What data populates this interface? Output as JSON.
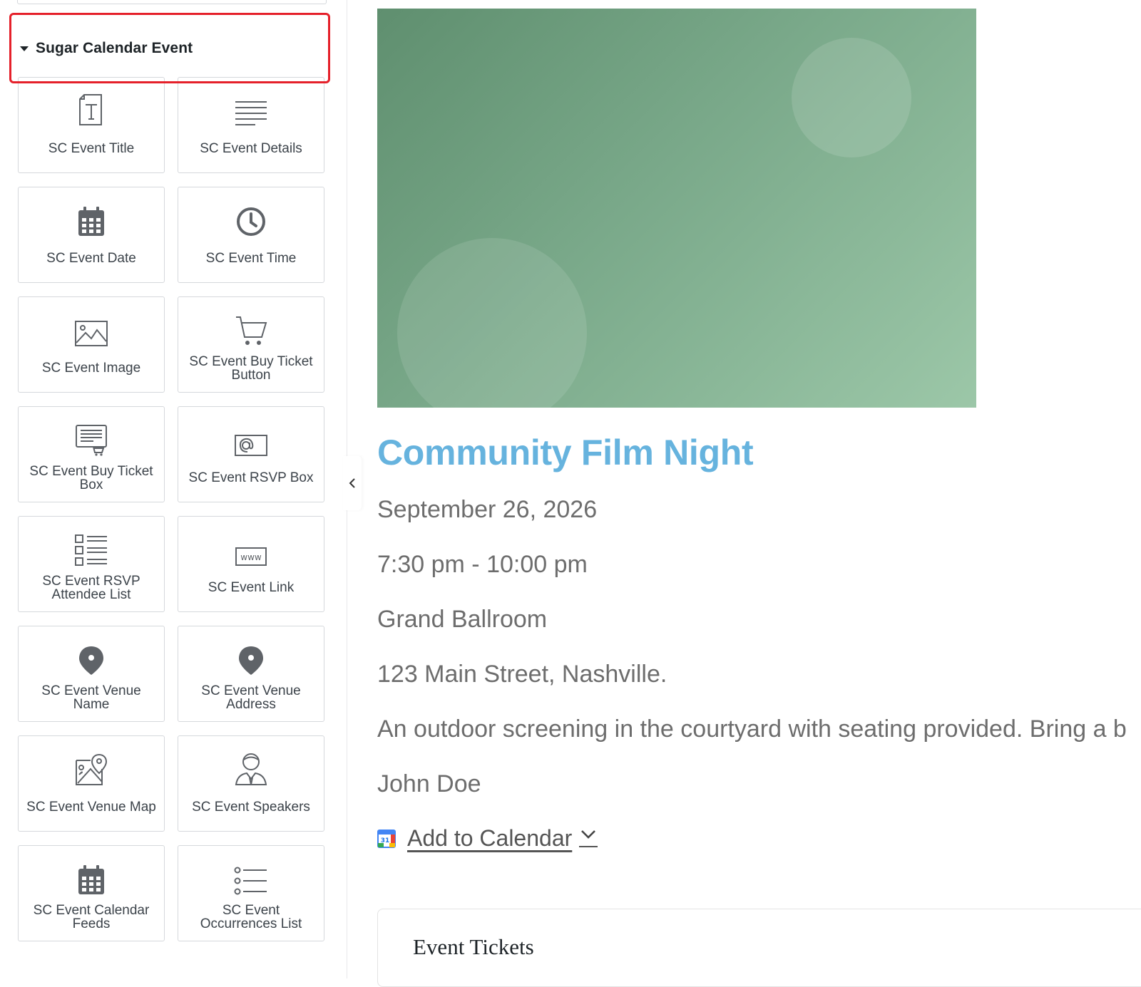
{
  "sidebar": {
    "category": "Sugar Calendar Event",
    "widgets": [
      {
        "label": "SC Event Title",
        "icon": "text-icon"
      },
      {
        "label": "SC Event Details",
        "icon": "align-lines-icon"
      },
      {
        "label": "SC Event Date",
        "icon": "calendar-icon"
      },
      {
        "label": "SC Event Time",
        "icon": "clock-icon"
      },
      {
        "label": "SC Event Image",
        "icon": "image-icon"
      },
      {
        "label": "SC Event Buy Ticket Button",
        "icon": "cart-icon"
      },
      {
        "label": "SC Event Buy Ticket Box",
        "icon": "ticket-box-icon"
      },
      {
        "label": "SC Event RSVP Box",
        "icon": "at-sign-icon"
      },
      {
        "label": "SC Event RSVP Attendee List",
        "icon": "checklist-icon"
      },
      {
        "label": "SC Event Link",
        "icon": "www-icon"
      },
      {
        "label": "SC Event Venue Name",
        "icon": "map-pin-icon"
      },
      {
        "label": "SC Event Venue Address",
        "icon": "map-pin-icon"
      },
      {
        "label": "SC Event Venue Map",
        "icon": "map-icon"
      },
      {
        "label": "SC Event Speakers",
        "icon": "person-icon"
      },
      {
        "label": "SC Event Calendar Feeds",
        "icon": "calendar-icon"
      },
      {
        "label": "SC Event Occurrences List",
        "icon": "list-icon"
      }
    ]
  },
  "event": {
    "title": "Community Film Night",
    "date": "September 26, 2026",
    "time": "7:30 pm - 10:00 pm",
    "venue": "Grand Ballroom",
    "address": "123 Main Street, Nashville.",
    "description": "An outdoor screening in the courtyard with seating provided. Bring a b",
    "speaker": "John Doe",
    "add_to_calendar": "Add to Calendar",
    "calendar_icon_day": "31",
    "tickets_heading": "Event Tickets"
  },
  "colors": {
    "title": "#66b3de",
    "highlight": "#e5202a",
    "text": "#6d6d6d"
  }
}
